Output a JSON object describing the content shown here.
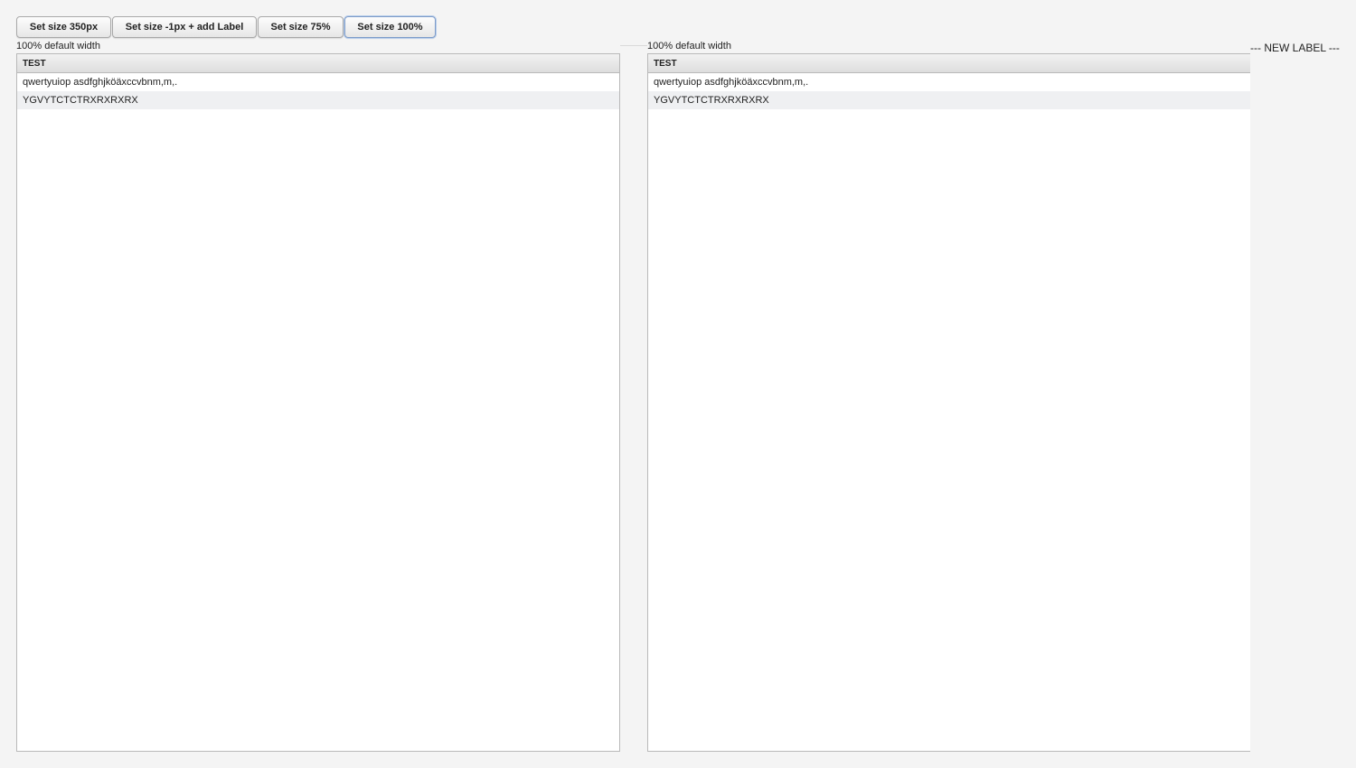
{
  "toolbar": {
    "buttons": [
      {
        "label": "Set size 350px"
      },
      {
        "label": "Set size -1px + add Label"
      },
      {
        "label": "Set size 75%"
      },
      {
        "label": "Set size 100%"
      }
    ]
  },
  "left_panel": {
    "caption": "100% default width",
    "table": {
      "header": "TEST",
      "rows": [
        "qwertyuiop asdfghjköäxccvbnm,m,.",
        "YGVYTCTCTRXRXRXRX"
      ]
    }
  },
  "right_panel": {
    "caption": "100% default width",
    "table": {
      "header": "TEST",
      "rows": [
        "qwertyuiop asdfghjköäxccvbnm,m,.",
        "YGVYTCTCTRXRXRXRX"
      ]
    }
  },
  "new_label": "--- NEW LABEL ---"
}
